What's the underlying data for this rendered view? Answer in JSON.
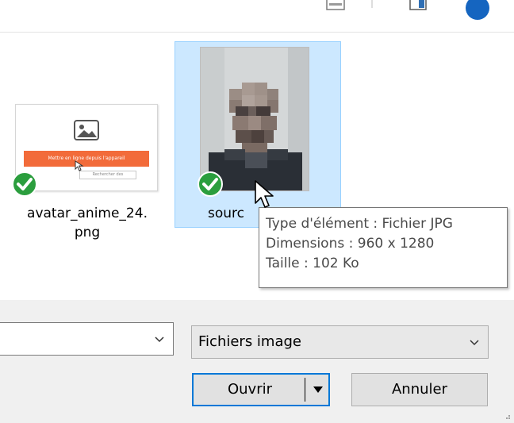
{
  "files": [
    {
      "name_line1": "avatar_anime_24.",
      "name_line2": "png",
      "thumb_button_text": "Mettre en ligne depuis l'appareil",
      "thumb_sub_text": "Rechercher des"
    },
    {
      "name_line1": "sourc",
      "selected": true
    }
  ],
  "tooltip": {
    "line1": "Type d'élément : Fichier JPG",
    "line2": "Dimensions : 960 x 1280",
    "line3": "Taille : 102 Ko"
  },
  "dialog": {
    "filename_value": "",
    "filetype_value": "Fichiers image",
    "open_label": "Ouvrir",
    "cancel_label": "Annuler"
  },
  "colors": {
    "selection_bg": "#cce8ff",
    "selection_border": "#99d1ff",
    "check_green": "#2b9e3e",
    "primary_border": "#0078d7",
    "orange": "#f26b3a"
  },
  "icons": [
    "view-icon",
    "preview-pane-icon",
    "help-icon",
    "image-icon",
    "check-icon",
    "cursor-icon",
    "chevron-down-icon",
    "resize-grip-icon"
  ]
}
